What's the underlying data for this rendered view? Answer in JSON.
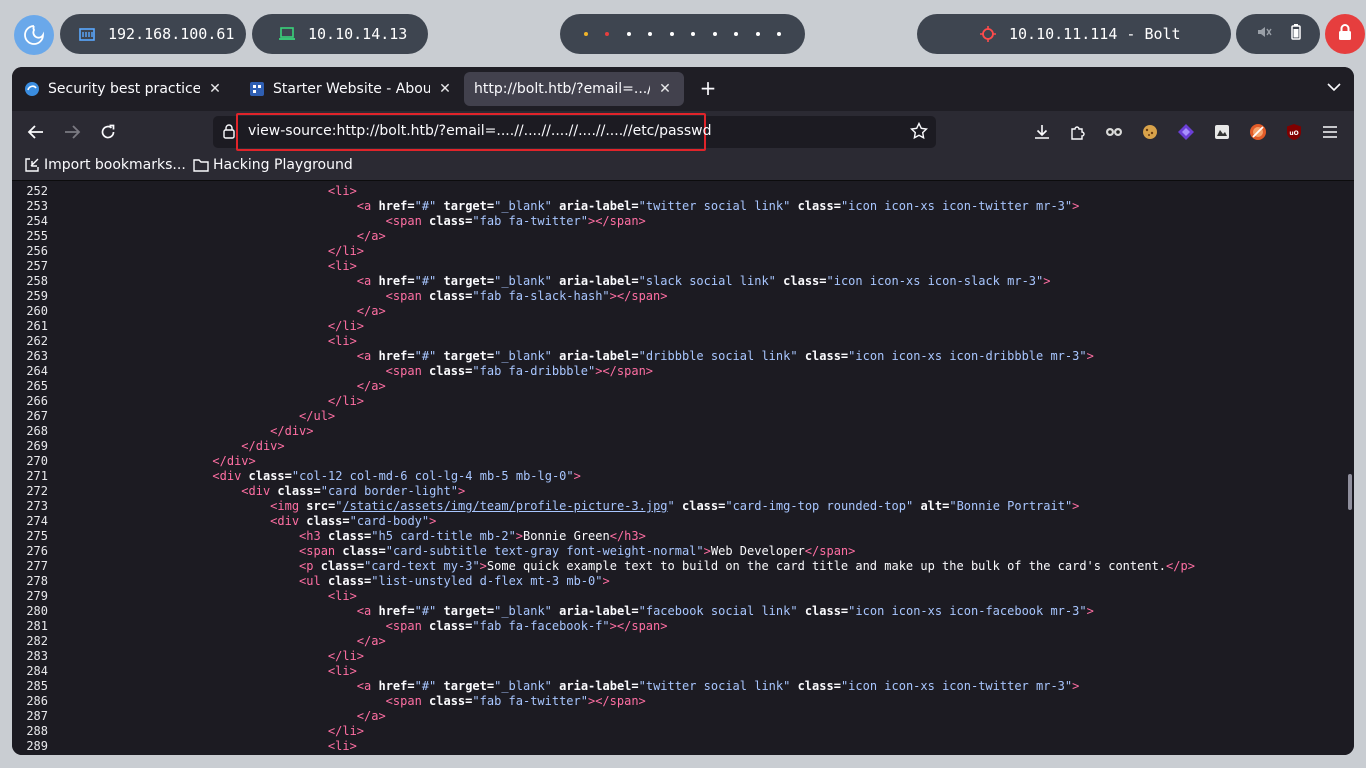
{
  "topbar": {
    "ip_local": "192.168.100.61",
    "ip_vpn": "10.10.14.13",
    "target": "10.10.11.114 - Bolt",
    "colors": {
      "pill": "#3e4550",
      "logo": "#6aa8ea",
      "lock": "#e63e3e"
    }
  },
  "browser": {
    "tabs": [
      {
        "label": "Security best practices |",
        "icon": "shield-icon"
      },
      {
        "label": "Starter Website - About",
        "icon": "site-icon"
      },
      {
        "label": "http://bolt.htb/?email=...//...",
        "icon": ""
      }
    ],
    "url": "view-source:http://bolt.htb/?email=....//....//....//....//....//etc/passwd",
    "bookmarks": [
      {
        "label": "Import bookmarks...",
        "icon": "import-icon"
      },
      {
        "label": "Hacking Playground",
        "icon": "folder-icon"
      }
    ]
  },
  "source": {
    "lines": [
      {
        "n": "252",
        "ind": 36,
        "segs": [
          [
            "t",
            "<li>"
          ]
        ]
      },
      {
        "n": "253",
        "ind": 40,
        "segs": [
          [
            "t",
            "<a "
          ],
          [
            "a",
            "href="
          ],
          [
            "v",
            "\"#\""
          ],
          [
            "tx",
            " "
          ],
          [
            "a",
            "target="
          ],
          [
            "v",
            "\"_blank\""
          ],
          [
            "tx",
            " "
          ],
          [
            "a",
            "aria-label="
          ],
          [
            "v",
            "\"twitter social link\""
          ],
          [
            "tx",
            " "
          ],
          [
            "a",
            "class="
          ],
          [
            "v",
            "\"icon icon-xs icon-twitter mr-3\""
          ],
          [
            "t",
            ">"
          ]
        ]
      },
      {
        "n": "254",
        "ind": 44,
        "segs": [
          [
            "t",
            "<span "
          ],
          [
            "a",
            "class="
          ],
          [
            "v",
            "\"fab fa-twitter\""
          ],
          [
            "t",
            "></span>"
          ]
        ]
      },
      {
        "n": "255",
        "ind": 40,
        "segs": [
          [
            "t",
            "</a>"
          ]
        ]
      },
      {
        "n": "256",
        "ind": 36,
        "segs": [
          [
            "t",
            "</li>"
          ]
        ]
      },
      {
        "n": "257",
        "ind": 36,
        "segs": [
          [
            "t",
            "<li>"
          ]
        ]
      },
      {
        "n": "258",
        "ind": 40,
        "segs": [
          [
            "t",
            "<a "
          ],
          [
            "a",
            "href="
          ],
          [
            "v",
            "\"#\""
          ],
          [
            "tx",
            " "
          ],
          [
            "a",
            "target="
          ],
          [
            "v",
            "\"_blank\""
          ],
          [
            "tx",
            " "
          ],
          [
            "a",
            "aria-label="
          ],
          [
            "v",
            "\"slack social link\""
          ],
          [
            "tx",
            " "
          ],
          [
            "a",
            "class="
          ],
          [
            "v",
            "\"icon icon-xs icon-slack mr-3\""
          ],
          [
            "t",
            ">"
          ]
        ]
      },
      {
        "n": "259",
        "ind": 44,
        "segs": [
          [
            "t",
            "<span "
          ],
          [
            "a",
            "class="
          ],
          [
            "v",
            "\"fab fa-slack-hash\""
          ],
          [
            "t",
            "></span>"
          ]
        ]
      },
      {
        "n": "260",
        "ind": 40,
        "segs": [
          [
            "t",
            "</a>"
          ]
        ]
      },
      {
        "n": "261",
        "ind": 36,
        "segs": [
          [
            "t",
            "</li>"
          ]
        ]
      },
      {
        "n": "262",
        "ind": 36,
        "segs": [
          [
            "t",
            "<li>"
          ]
        ]
      },
      {
        "n": "263",
        "ind": 40,
        "segs": [
          [
            "t",
            "<a "
          ],
          [
            "a",
            "href="
          ],
          [
            "v",
            "\"#\""
          ],
          [
            "tx",
            " "
          ],
          [
            "a",
            "target="
          ],
          [
            "v",
            "\"_blank\""
          ],
          [
            "tx",
            " "
          ],
          [
            "a",
            "aria-label="
          ],
          [
            "v",
            "\"dribbble social link\""
          ],
          [
            "tx",
            " "
          ],
          [
            "a",
            "class="
          ],
          [
            "v",
            "\"icon icon-xs icon-dribbble mr-3\""
          ],
          [
            "t",
            ">"
          ]
        ]
      },
      {
        "n": "264",
        "ind": 44,
        "segs": [
          [
            "t",
            "<span "
          ],
          [
            "a",
            "class="
          ],
          [
            "v",
            "\"fab fa-dribbble\""
          ],
          [
            "t",
            "></span>"
          ]
        ]
      },
      {
        "n": "265",
        "ind": 40,
        "segs": [
          [
            "t",
            "</a>"
          ]
        ]
      },
      {
        "n": "266",
        "ind": 36,
        "segs": [
          [
            "t",
            "</li>"
          ]
        ]
      },
      {
        "n": "267",
        "ind": 32,
        "segs": [
          [
            "t",
            "</ul>"
          ]
        ]
      },
      {
        "n": "268",
        "ind": 28,
        "segs": [
          [
            "t",
            "</div>"
          ]
        ]
      },
      {
        "n": "269",
        "ind": 24,
        "segs": [
          [
            "t",
            "</div>"
          ]
        ]
      },
      {
        "n": "270",
        "ind": 20,
        "segs": [
          [
            "t",
            "</div>"
          ]
        ]
      },
      {
        "n": "271",
        "ind": 20,
        "segs": [
          [
            "t",
            "<div "
          ],
          [
            "a",
            "class="
          ],
          [
            "v",
            "\"col-12 col-md-6 col-lg-4 mb-5 mb-lg-0\""
          ],
          [
            "t",
            ">"
          ]
        ]
      },
      {
        "n": "272",
        "ind": 24,
        "segs": [
          [
            "t",
            "<div "
          ],
          [
            "a",
            "class="
          ],
          [
            "v",
            "\"card border-light\""
          ],
          [
            "t",
            ">"
          ]
        ]
      },
      {
        "n": "273",
        "ind": 28,
        "segs": [
          [
            "t",
            "<img "
          ],
          [
            "a",
            "src="
          ],
          [
            "v",
            "\""
          ],
          [
            "lk",
            "/static/assets/img/team/profile-picture-3.jpg"
          ],
          [
            "v",
            "\""
          ],
          [
            "tx",
            " "
          ],
          [
            "a",
            "class="
          ],
          [
            "v",
            "\"card-img-top rounded-top\""
          ],
          [
            "tx",
            " "
          ],
          [
            "a",
            "alt="
          ],
          [
            "v",
            "\"Bonnie Portrait\""
          ],
          [
            "t",
            ">"
          ]
        ]
      },
      {
        "n": "274",
        "ind": 28,
        "segs": [
          [
            "t",
            "<div "
          ],
          [
            "a",
            "class="
          ],
          [
            "v",
            "\"card-body\""
          ],
          [
            "t",
            ">"
          ]
        ]
      },
      {
        "n": "275",
        "ind": 32,
        "segs": [
          [
            "t",
            "<h3 "
          ],
          [
            "a",
            "class="
          ],
          [
            "v",
            "\"h5 card-title mb-2\""
          ],
          [
            "t",
            ">"
          ],
          [
            "tx",
            "Bonnie Green"
          ],
          [
            "t",
            "</h3>"
          ]
        ]
      },
      {
        "n": "276",
        "ind": 32,
        "segs": [
          [
            "t",
            "<span "
          ],
          [
            "a",
            "class="
          ],
          [
            "v",
            "\"card-subtitle text-gray font-weight-normal\""
          ],
          [
            "t",
            ">"
          ],
          [
            "tx",
            "Web Developer"
          ],
          [
            "t",
            "</span>"
          ]
        ]
      },
      {
        "n": "277",
        "ind": 32,
        "segs": [
          [
            "t",
            "<p "
          ],
          [
            "a",
            "class="
          ],
          [
            "v",
            "\"card-text my-3\""
          ],
          [
            "t",
            ">"
          ],
          [
            "tx",
            "Some quick example text to build on the card title and make up the bulk of the card's content."
          ],
          [
            "t",
            "</p>"
          ]
        ]
      },
      {
        "n": "278",
        "ind": 32,
        "segs": [
          [
            "t",
            "<ul "
          ],
          [
            "a",
            "class="
          ],
          [
            "v",
            "\"list-unstyled d-flex mt-3 mb-0\""
          ],
          [
            "t",
            ">"
          ]
        ]
      },
      {
        "n": "279",
        "ind": 36,
        "segs": [
          [
            "t",
            "<li>"
          ]
        ]
      },
      {
        "n": "280",
        "ind": 40,
        "segs": [
          [
            "t",
            "<a "
          ],
          [
            "a",
            "href="
          ],
          [
            "v",
            "\"#\""
          ],
          [
            "tx",
            " "
          ],
          [
            "a",
            "target="
          ],
          [
            "v",
            "\"_blank\""
          ],
          [
            "tx",
            " "
          ],
          [
            "a",
            "aria-label="
          ],
          [
            "v",
            "\"facebook social link\""
          ],
          [
            "tx",
            " "
          ],
          [
            "a",
            "class="
          ],
          [
            "v",
            "\"icon icon-xs icon-facebook mr-3\""
          ],
          [
            "t",
            ">"
          ]
        ]
      },
      {
        "n": "281",
        "ind": 44,
        "segs": [
          [
            "t",
            "<span "
          ],
          [
            "a",
            "class="
          ],
          [
            "v",
            "\"fab fa-facebook-f\""
          ],
          [
            "t",
            "></span>"
          ]
        ]
      },
      {
        "n": "282",
        "ind": 40,
        "segs": [
          [
            "t",
            "</a>"
          ]
        ]
      },
      {
        "n": "283",
        "ind": 36,
        "segs": [
          [
            "t",
            "</li>"
          ]
        ]
      },
      {
        "n": "284",
        "ind": 36,
        "segs": [
          [
            "t",
            "<li>"
          ]
        ]
      },
      {
        "n": "285",
        "ind": 40,
        "segs": [
          [
            "t",
            "<a "
          ],
          [
            "a",
            "href="
          ],
          [
            "v",
            "\"#\""
          ],
          [
            "tx",
            " "
          ],
          [
            "a",
            "target="
          ],
          [
            "v",
            "\"_blank\""
          ],
          [
            "tx",
            " "
          ],
          [
            "a",
            "aria-label="
          ],
          [
            "v",
            "\"twitter social link\""
          ],
          [
            "tx",
            " "
          ],
          [
            "a",
            "class="
          ],
          [
            "v",
            "\"icon icon-xs icon-twitter mr-3\""
          ],
          [
            "t",
            ">"
          ]
        ]
      },
      {
        "n": "286",
        "ind": 44,
        "segs": [
          [
            "t",
            "<span "
          ],
          [
            "a",
            "class="
          ],
          [
            "v",
            "\"fab fa-twitter\""
          ],
          [
            "t",
            "></span>"
          ]
        ]
      },
      {
        "n": "287",
        "ind": 40,
        "segs": [
          [
            "t",
            "</a>"
          ]
        ]
      },
      {
        "n": "288",
        "ind": 36,
        "segs": [
          [
            "t",
            "</li>"
          ]
        ]
      },
      {
        "n": "289",
        "ind": 36,
        "segs": [
          [
            "t",
            "<li>"
          ]
        ]
      }
    ],
    "colors": {
      "tag": "#ff6fa3",
      "attr": "#fbfbfe",
      "value": "#a8c6ff",
      "background": "#1c1b22"
    }
  }
}
